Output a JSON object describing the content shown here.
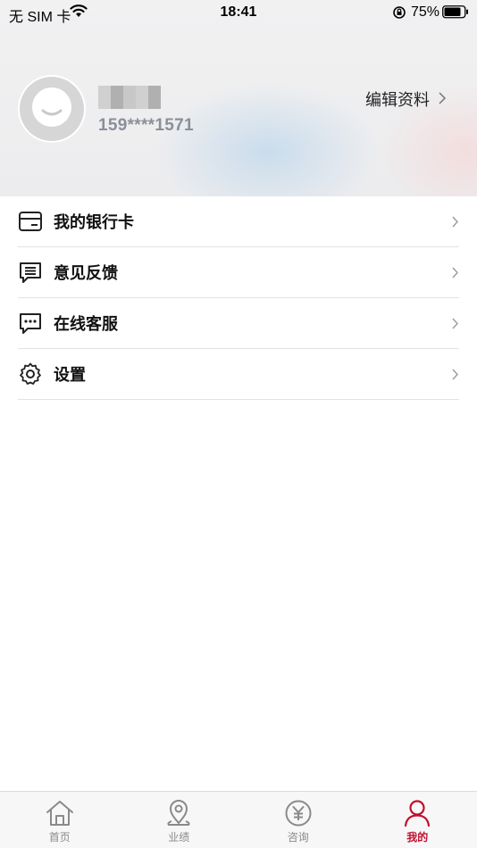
{
  "status_bar": {
    "carrier": "无 SIM 卡",
    "time": "18:41",
    "battery": "75%"
  },
  "profile": {
    "name": "████",
    "phone": "159****1571",
    "edit_label": "编辑资料"
  },
  "menu": [
    {
      "label": "我的银行卡",
      "icon": "bank-card-icon"
    },
    {
      "label": "意见反馈",
      "icon": "feedback-icon"
    },
    {
      "label": "在线客服",
      "icon": "chat-icon"
    },
    {
      "label": "设置",
      "icon": "gear-icon"
    }
  ],
  "tabs": [
    {
      "label": "首页",
      "icon": "home-icon",
      "active": false
    },
    {
      "label": "业绩",
      "icon": "location-pin-icon",
      "active": false
    },
    {
      "label": "咨询",
      "icon": "yuan-icon",
      "active": false
    },
    {
      "label": "我的",
      "icon": "person-icon",
      "active": true
    }
  ],
  "colors": {
    "accent": "#c0102e",
    "inactive": "#8a8a8a",
    "phone": "#8a8f99"
  }
}
